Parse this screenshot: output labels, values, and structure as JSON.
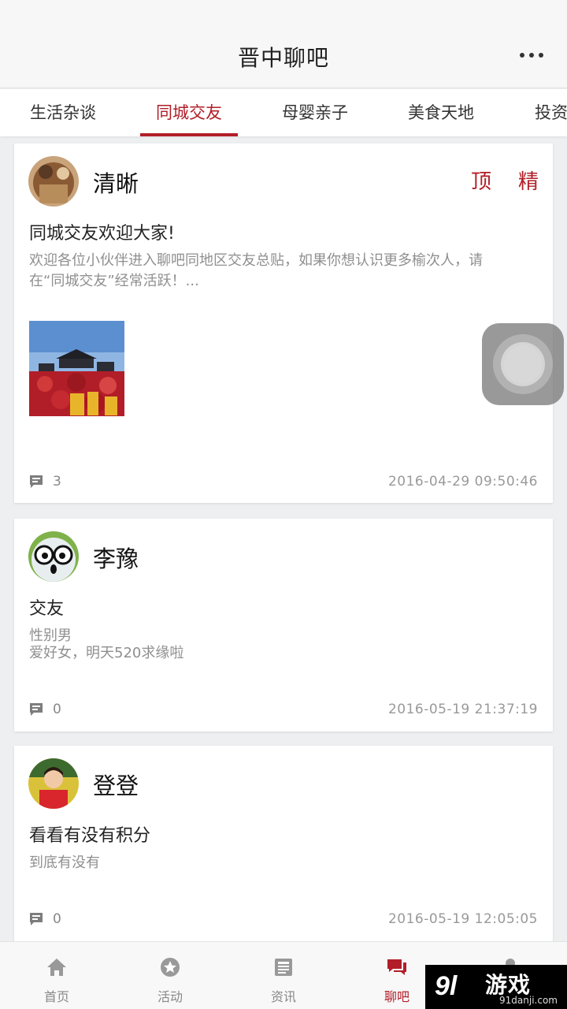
{
  "header": {
    "title": "晋中聊吧"
  },
  "tabs": [
    "生活杂谈",
    "同城交友",
    "母婴亲子",
    "美食天地",
    "投资"
  ],
  "posts": [
    {
      "author": "清晰",
      "title": "同城交友欢迎大家!",
      "excerpt": "欢迎各位小伙伴进入聊吧同地区交友总贴，如果你想认识更多榆次人，请在“同城交友”经常活跃！...",
      "badges": [
        "顶",
        "精"
      ],
      "comments": "3",
      "time": "2016-04-29 09:50:46"
    },
    {
      "author": "李豫",
      "title": "交友",
      "excerpt_lines": [
        "性别男",
        "爱好女，明天520求缘啦"
      ],
      "comments": "0",
      "time": "2016-05-19 21:37:19"
    },
    {
      "author": "登登",
      "title": "看看有没有积分",
      "excerpt": "到底有没有",
      "comments": "0",
      "time": "2016-05-19 12:05:05"
    }
  ],
  "nav": [
    {
      "label": "首页",
      "icon": "home-icon"
    },
    {
      "label": "活动",
      "icon": "star-icon"
    },
    {
      "label": "资讯",
      "icon": "news-icon"
    },
    {
      "label": "聊吧",
      "icon": "chat-icon"
    },
    {
      "label": "",
      "icon": "user-icon"
    }
  ],
  "watermark": {
    "brand": "游戏",
    "number": "9l",
    "site": "91danji.com"
  },
  "colors": {
    "accent": "#b21e28",
    "background": "#eeeff1"
  }
}
